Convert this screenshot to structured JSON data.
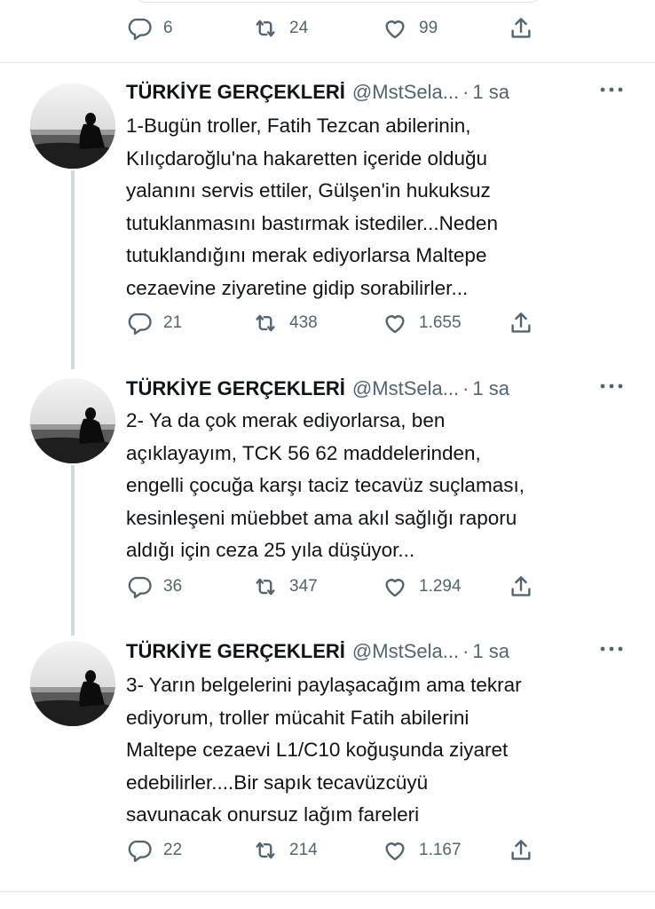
{
  "top_tweet": {
    "reply_count": "6",
    "retweet_count": "24",
    "like_count": "99"
  },
  "tweets": [
    {
      "name": "TÜRKİYE GERÇEKLERİ",
      "handle": "@MstSela...",
      "separator": "·",
      "time": "1 sa",
      "text": "1-Bugün troller, Fatih Tezcan abilerinin,\nKılıçdaroğlu'na hakaretten içeride olduğu\nyalanını servis ettiler, Gülşen'in hukuksuz\ntutuklanmasını bastırmak istediler...Neden\ntutuklandığını merak ediyorlarsa Maltepe\ncezaevine ziyaretine gidip sorabilirler...",
      "reply_count": "21",
      "retweet_count": "438",
      "like_count": "1.655"
    },
    {
      "name": "TÜRKİYE GERÇEKLERİ",
      "handle": "@MstSela...",
      "separator": "·",
      "time": "1 sa",
      "text": "2- Ya da çok merak ediyorlarsa, ben\naçıklayayım, TCK 56 62 maddelerinden,\nengelli çocuğa karşı taciz tecavüz suçlaması,\nkesinleşeni müebbet ama akıl sağlığı raporu\naldığı için ceza 25 yıla düşüyor...",
      "reply_count": "36",
      "retweet_count": "347",
      "like_count": "1.294"
    },
    {
      "name": "TÜRKİYE GERÇEKLERİ",
      "handle": "@MstSela...",
      "separator": "·",
      "time": "1 sa",
      "text": "3- Yarın belgelerini paylaşacağım ama tekrar\nediyorum, troller mücahit Fatih abilerini\nMaltepe cezaevi L1/C10 koğuşunda ziyaret\nedebilirler....Bir sapık tecavüzcüyü\nsavunacak onursuz lağım fareleri",
      "reply_count": "22",
      "retweet_count": "214",
      "like_count": "1.167"
    }
  ],
  "icons": {
    "reply": "reply-icon",
    "retweet": "retweet-icon",
    "like": "heart-icon",
    "share": "share-icon",
    "more": "more-icon"
  },
  "colors": {
    "text": "#0f1419",
    "secondary": "#536471",
    "divider": "#e3e6e8",
    "thread_line": "#cfd9de"
  }
}
